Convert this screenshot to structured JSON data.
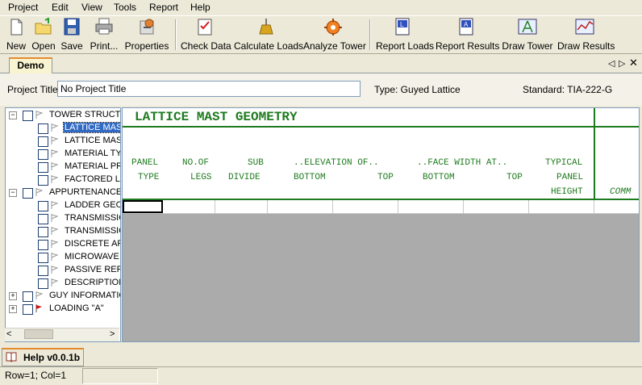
{
  "menu": [
    "Project",
    "Edit",
    "View",
    "Tools",
    "Report",
    "Help"
  ],
  "toolbar": {
    "new": "New",
    "open": "Open",
    "save": "Save",
    "print": "Print...",
    "properties": "Properties",
    "check_data": "Check Data",
    "calculate_loads": "Calculate Loads",
    "analyze_tower": "Analyze Tower",
    "report_loads": "Report Loads",
    "report_results": "Report Results",
    "draw_tower": "Draw Tower",
    "draw_results": "Draw Results"
  },
  "tab": {
    "label": "Demo"
  },
  "project": {
    "title_label": "Project Title:",
    "title_value": "No Project Title",
    "type_text": "Type: Guyed Lattice",
    "standard_text": "Standard:  TIA-222-G"
  },
  "tree": {
    "items": [
      "TOWER STRUCTU",
      "LATTICE MAS",
      "LATTICE MAS",
      "MATERIAL TY",
      "MATERIAL PR",
      "FACTORED LE",
      "APPURTENANCES",
      "LADDER GEO",
      "TRANSMISSIO",
      "TRANSMISSIO",
      "DISCRETE AP",
      "MICROWAVE",
      "PASSIVE REF",
      "DESCRIPTION",
      "GUY INFORMATIC",
      "LOADING \"A\""
    ]
  },
  "grid": {
    "title": "LATTICE MAST GEOMETRY",
    "headers": {
      "panel": [
        "PANEL",
        "TYPE"
      ],
      "legs": [
        "NO.OF",
        "LEGS"
      ],
      "sub": [
        "SUB",
        "DIVIDE"
      ],
      "elevation": [
        "..ELEVATION OF..",
        "BOTTOM",
        "TOP"
      ],
      "face": [
        "..FACE WIDTH AT..",
        "BOTTOM",
        "TOP"
      ],
      "typical": [
        "TYPICAL",
        "PANEL",
        "HEIGHT"
      ],
      "comments": "COMM"
    }
  },
  "bottom": {
    "help_tab": "Help v0.0.1b",
    "status": "Row=1;  Col=1"
  }
}
